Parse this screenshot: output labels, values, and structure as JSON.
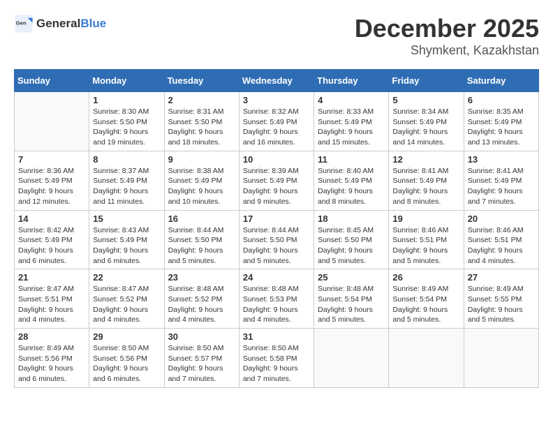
{
  "logo": {
    "text_general": "General",
    "text_blue": "Blue"
  },
  "header": {
    "month": "December 2025",
    "location": "Shymkent, Kazakhstan"
  },
  "days_of_week": [
    "Sunday",
    "Monday",
    "Tuesday",
    "Wednesday",
    "Thursday",
    "Friday",
    "Saturday"
  ],
  "weeks": [
    [
      {
        "day": "",
        "info": ""
      },
      {
        "day": "1",
        "info": "Sunrise: 8:30 AM\nSunset: 5:50 PM\nDaylight: 9 hours\nand 19 minutes."
      },
      {
        "day": "2",
        "info": "Sunrise: 8:31 AM\nSunset: 5:50 PM\nDaylight: 9 hours\nand 18 minutes."
      },
      {
        "day": "3",
        "info": "Sunrise: 8:32 AM\nSunset: 5:49 PM\nDaylight: 9 hours\nand 16 minutes."
      },
      {
        "day": "4",
        "info": "Sunrise: 8:33 AM\nSunset: 5:49 PM\nDaylight: 9 hours\nand 15 minutes."
      },
      {
        "day": "5",
        "info": "Sunrise: 8:34 AM\nSunset: 5:49 PM\nDaylight: 9 hours\nand 14 minutes."
      },
      {
        "day": "6",
        "info": "Sunrise: 8:35 AM\nSunset: 5:49 PM\nDaylight: 9 hours\nand 13 minutes."
      }
    ],
    [
      {
        "day": "7",
        "info": "Sunrise: 8:36 AM\nSunset: 5:49 PM\nDaylight: 9 hours\nand 12 minutes."
      },
      {
        "day": "8",
        "info": "Sunrise: 8:37 AM\nSunset: 5:49 PM\nDaylight: 9 hours\nand 11 minutes."
      },
      {
        "day": "9",
        "info": "Sunrise: 8:38 AM\nSunset: 5:49 PM\nDaylight: 9 hours\nand 10 minutes."
      },
      {
        "day": "10",
        "info": "Sunrise: 8:39 AM\nSunset: 5:49 PM\nDaylight: 9 hours\nand 9 minutes."
      },
      {
        "day": "11",
        "info": "Sunrise: 8:40 AM\nSunset: 5:49 PM\nDaylight: 9 hours\nand 8 minutes."
      },
      {
        "day": "12",
        "info": "Sunrise: 8:41 AM\nSunset: 5:49 PM\nDaylight: 9 hours\nand 8 minutes."
      },
      {
        "day": "13",
        "info": "Sunrise: 8:41 AM\nSunset: 5:49 PM\nDaylight: 9 hours\nand 7 minutes."
      }
    ],
    [
      {
        "day": "14",
        "info": "Sunrise: 8:42 AM\nSunset: 5:49 PM\nDaylight: 9 hours\nand 6 minutes."
      },
      {
        "day": "15",
        "info": "Sunrise: 8:43 AM\nSunset: 5:49 PM\nDaylight: 9 hours\nand 6 minutes."
      },
      {
        "day": "16",
        "info": "Sunrise: 8:44 AM\nSunset: 5:50 PM\nDaylight: 9 hours\nand 5 minutes."
      },
      {
        "day": "17",
        "info": "Sunrise: 8:44 AM\nSunset: 5:50 PM\nDaylight: 9 hours\nand 5 minutes."
      },
      {
        "day": "18",
        "info": "Sunrise: 8:45 AM\nSunset: 5:50 PM\nDaylight: 9 hours\nand 5 minutes."
      },
      {
        "day": "19",
        "info": "Sunrise: 8:46 AM\nSunset: 5:51 PM\nDaylight: 9 hours\nand 5 minutes."
      },
      {
        "day": "20",
        "info": "Sunrise: 8:46 AM\nSunset: 5:51 PM\nDaylight: 9 hours\nand 4 minutes."
      }
    ],
    [
      {
        "day": "21",
        "info": "Sunrise: 8:47 AM\nSunset: 5:51 PM\nDaylight: 9 hours\nand 4 minutes."
      },
      {
        "day": "22",
        "info": "Sunrise: 8:47 AM\nSunset: 5:52 PM\nDaylight: 9 hours\nand 4 minutes."
      },
      {
        "day": "23",
        "info": "Sunrise: 8:48 AM\nSunset: 5:52 PM\nDaylight: 9 hours\nand 4 minutes."
      },
      {
        "day": "24",
        "info": "Sunrise: 8:48 AM\nSunset: 5:53 PM\nDaylight: 9 hours\nand 4 minutes."
      },
      {
        "day": "25",
        "info": "Sunrise: 8:48 AM\nSunset: 5:54 PM\nDaylight: 9 hours\nand 5 minutes."
      },
      {
        "day": "26",
        "info": "Sunrise: 8:49 AM\nSunset: 5:54 PM\nDaylight: 9 hours\nand 5 minutes."
      },
      {
        "day": "27",
        "info": "Sunrise: 8:49 AM\nSunset: 5:55 PM\nDaylight: 9 hours\nand 5 minutes."
      }
    ],
    [
      {
        "day": "28",
        "info": "Sunrise: 8:49 AM\nSunset: 5:56 PM\nDaylight: 9 hours\nand 6 minutes."
      },
      {
        "day": "29",
        "info": "Sunrise: 8:50 AM\nSunset: 5:56 PM\nDaylight: 9 hours\nand 6 minutes."
      },
      {
        "day": "30",
        "info": "Sunrise: 8:50 AM\nSunset: 5:57 PM\nDaylight: 9 hours\nand 7 minutes."
      },
      {
        "day": "31",
        "info": "Sunrise: 8:50 AM\nSunset: 5:58 PM\nDaylight: 9 hours\nand 7 minutes."
      },
      {
        "day": "",
        "info": ""
      },
      {
        "day": "",
        "info": ""
      },
      {
        "day": "",
        "info": ""
      }
    ]
  ]
}
